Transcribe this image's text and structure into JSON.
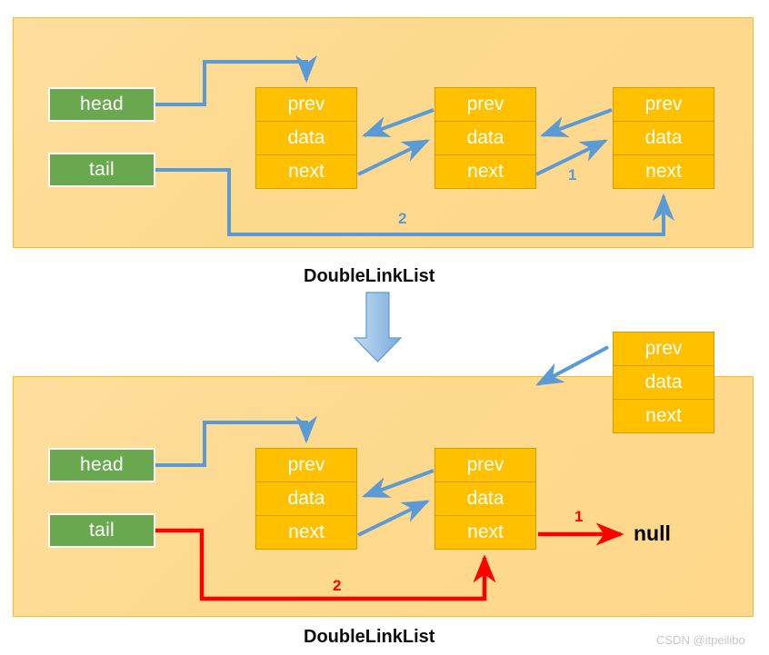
{
  "diagram": {
    "title_top": "DoubleLinkList",
    "title_bottom": "DoubleLinkList",
    "watermark": "CSDN @itpeilibo",
    "null_label": "null",
    "colors": {
      "panel_fill": "#ffd98e",
      "panel_border": "#f5bd1f",
      "node_fill": "#ffc000",
      "node_border": "#d79b00",
      "pointer_fill": "#6aa84f",
      "link_blue": "#5b9bd5",
      "link_red": "#ff0000",
      "text_white": "#ffffff",
      "caption_text": "#0d0d0d",
      "watermark_text": "#c8c8c8"
    }
  },
  "top_panel": {
    "pointers": [
      {
        "label": "head"
      },
      {
        "label": "tail"
      }
    ],
    "nodes": [
      {
        "fields": [
          "prev",
          "data",
          "next"
        ]
      },
      {
        "fields": [
          "prev",
          "data",
          "next"
        ]
      },
      {
        "fields": [
          "prev",
          "data",
          "next"
        ]
      }
    ],
    "step_labels": [
      {
        "text": "1"
      },
      {
        "text": "2"
      }
    ]
  },
  "bottom_panel": {
    "pointers": [
      {
        "label": "head"
      },
      {
        "label": "tail"
      }
    ],
    "nodes": [
      {
        "fields": [
          "prev",
          "data",
          "next"
        ]
      },
      {
        "fields": [
          "prev",
          "data",
          "next"
        ]
      }
    ],
    "detached_node": {
      "fields": [
        "prev",
        "data",
        "next"
      ]
    },
    "step_labels": [
      {
        "text": "1"
      },
      {
        "text": "2"
      }
    ],
    "null_target": "null"
  }
}
